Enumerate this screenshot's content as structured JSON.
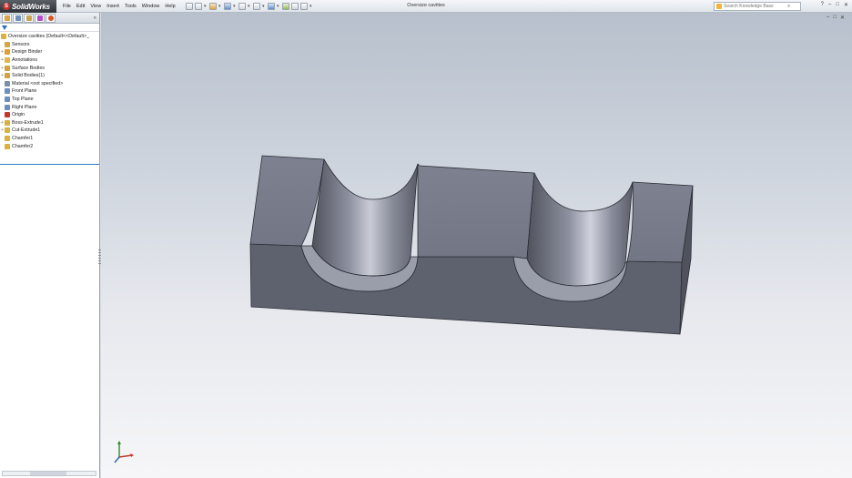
{
  "app": {
    "brand": "SolidWorks",
    "document_title": "Oversize cavities",
    "menu": [
      "File",
      "Edit",
      "View",
      "Insert",
      "Tools",
      "Window",
      "Help"
    ]
  },
  "search": {
    "placeholder": "Search Knowledge Base"
  },
  "window_controls": [
    "?",
    "–",
    "□",
    "✕"
  ],
  "viewport_controls": [
    "–",
    "□",
    "✕"
  ],
  "feature_tree": {
    "root": "Oversize cavities  (Default<<Default>_",
    "items": [
      {
        "label": "Sensors",
        "icon": "sensors-icon",
        "color": "#d9a441",
        "expandable": false
      },
      {
        "label": "Design Binder",
        "icon": "design-binder-icon",
        "color": "#e0a030",
        "expandable": true
      },
      {
        "label": "Annotations",
        "icon": "annotations-icon",
        "color": "#e3b44a",
        "expandable": true
      },
      {
        "label": "Surface Bodies",
        "icon": "surface-bodies-icon",
        "color": "#d4a23e",
        "expandable": true
      },
      {
        "label": "Solid Bodies(1)",
        "icon": "solid-bodies-icon",
        "color": "#d4a23e",
        "expandable": true
      },
      {
        "label": "Material <not specified>",
        "icon": "material-icon",
        "color": "#7a8fa8",
        "expandable": false
      },
      {
        "label": "Front Plane",
        "icon": "plane-icon",
        "color": "#6a8fc0",
        "expandable": false
      },
      {
        "label": "Top Plane",
        "icon": "plane-icon",
        "color": "#6a8fc0",
        "expandable": false
      },
      {
        "label": "Right Plane",
        "icon": "plane-icon",
        "color": "#6a8fc0",
        "expandable": false
      },
      {
        "label": "Origin",
        "icon": "origin-icon",
        "color": "#c0392b",
        "expandable": false
      },
      {
        "label": "Boss-Extrude1",
        "icon": "boss-extrude-icon",
        "color": "#d8b23b",
        "expandable": true
      },
      {
        "label": "Cut-Extrude1",
        "icon": "cut-extrude-icon",
        "color": "#d8b23b",
        "expandable": true
      },
      {
        "label": "Chamfer1",
        "icon": "chamfer-icon",
        "color": "#d8b23b",
        "expandable": false
      },
      {
        "label": "Chamfer2",
        "icon": "chamfer-icon",
        "color": "#d8b23b",
        "expandable": false
      }
    ]
  },
  "colors": {
    "selection_accent": "#2e79c7",
    "model_face_top": "#7a7e8c",
    "model_face_front": "#5f636f",
    "model_face_side": "#52555f"
  }
}
